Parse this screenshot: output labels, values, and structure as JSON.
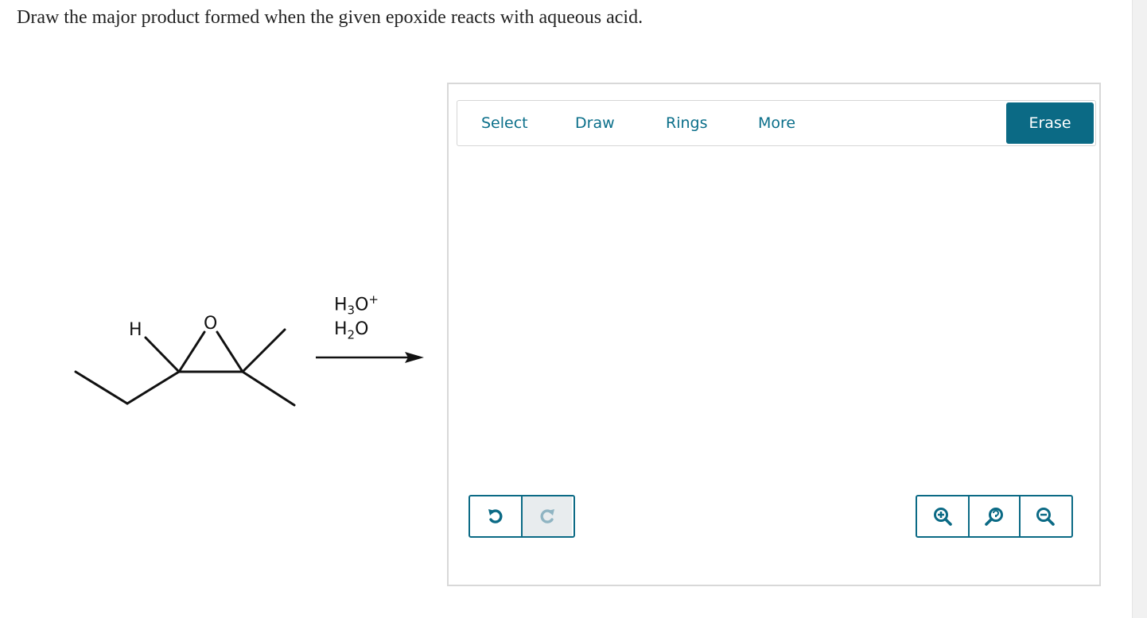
{
  "question": "Draw the major product formed when the given epoxide reacts with aqueous acid.",
  "molecule": {
    "atom_h": "H",
    "atom_o": "O"
  },
  "reagents": {
    "line1_base": "H",
    "line1_sub": "3",
    "line1_o": "O",
    "line1_sup": "+",
    "line2_base": "H",
    "line2_sub": "2",
    "line2_o": "O"
  },
  "toolbar": {
    "select": "Select",
    "draw": "Draw",
    "rings": "Rings",
    "more": "More",
    "erase": "Erase"
  },
  "history": {
    "undo_icon": "undo-icon",
    "redo_icon": "redo-icon",
    "redo_enabled": false
  },
  "zoom": {
    "zoom_in_icon": "zoom-in-icon",
    "reset_icon": "zoom-reset-icon",
    "zoom_out_icon": "zoom-out-icon"
  },
  "colors": {
    "accent": "#0b6a85",
    "link": "#0b6f8a"
  }
}
